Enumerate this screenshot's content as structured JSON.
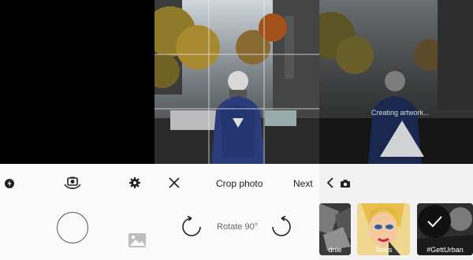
{
  "camera": {
    "flash_icon": "flash-icon",
    "switch_icon": "switch-camera-icon",
    "settings_icon": "gear-icon",
    "gallery_icon": "gallery-icon"
  },
  "crop": {
    "title": "Crop photo",
    "next_label": "Next",
    "rotate_label": "Rotate 90°",
    "close_icon": "close-icon"
  },
  "filter": {
    "status": "Creating artwork...",
    "thumbs": [
      {
        "label": "dnie"
      },
      {
        "label": "Tears"
      },
      {
        "label": "#GettUrban"
      }
    ],
    "back_icon": "chevron-left-icon",
    "camera_icon": "camera-icon",
    "check_icon": "check-icon"
  },
  "colors": {
    "bar": "#f7f7f7",
    "text": "#1a1a1a"
  }
}
